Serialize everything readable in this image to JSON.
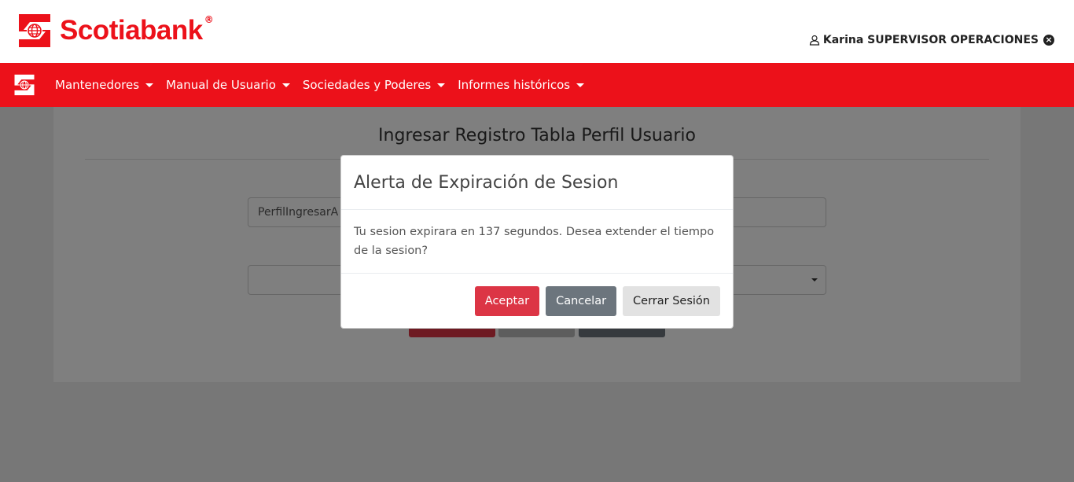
{
  "header": {
    "brand": "Scotiabank",
    "registered": "®",
    "user": "Karina SUPERVISOR OPERACIONES"
  },
  "nav": {
    "items": [
      {
        "label": "Mantenedores"
      },
      {
        "label": "Manual de Usuario"
      },
      {
        "label": "Sociedades y Poderes"
      },
      {
        "label": "Informes históricos"
      }
    ]
  },
  "page": {
    "title": "Ingresar Registro Tabla Perfil Usuario",
    "field1_value": "PerfilIngresarA"
  },
  "modal": {
    "title": "Alerta de Expiración de Sesion",
    "body": "Tu sesion expirara en 137 segundos. Desea extender el tiempo de la sesion?",
    "accept": "Aceptar",
    "cancel": "Cancelar",
    "logout": "Cerrar Sesión"
  },
  "colors": {
    "brand_red": "#ec111a",
    "accept_button": "#dc3545",
    "cancel_button": "#6c757d"
  }
}
